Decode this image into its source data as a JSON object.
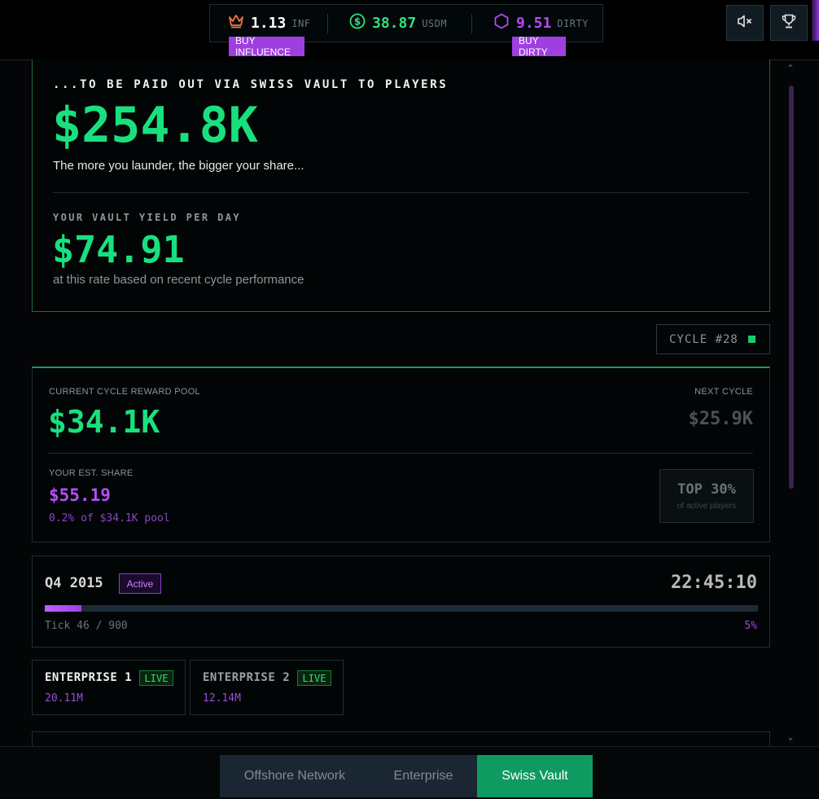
{
  "topbar": {
    "influence": {
      "value": "1.13",
      "unit": "INF",
      "buy_label": "BUY INFLUENCE",
      "color": "#f1743a"
    },
    "usdm": {
      "value": "38.87",
      "unit": "USDM",
      "color": "#2fe07c"
    },
    "dirty": {
      "value": "9.51",
      "unit": "DIRTY",
      "buy_label": "BUY DIRTY",
      "color": "#b24bf0"
    },
    "buttons": [
      "mute-icon",
      "trophy-icon"
    ]
  },
  "vault": {
    "eyebrow": "...TO BE PAID OUT VIA SWISS VAULT TO PLAYERS",
    "amount": "$254.8K",
    "tagline": "The more you launder, the bigger your share...",
    "yield_label": "YOUR VAULT YIELD PER DAY",
    "yield_amount": "$74.91",
    "yield_note": "at this rate based on recent cycle performance"
  },
  "cycle": {
    "label": "CYCLE #28"
  },
  "pool": {
    "current_label": "CURRENT CYCLE REWARD POOL",
    "current_amount": "$34.1K",
    "next_label": "NEXT CYCLE",
    "next_amount": "$25.9K",
    "share_label": "YOUR EST. SHARE",
    "share_amount": "$55.19",
    "share_note": "0.2% of $34.1K pool",
    "rank_title": "TOP 30%",
    "rank_sub": "of active players"
  },
  "quarter": {
    "title": "Q4 2015",
    "badge": "Active",
    "timer": "22:45:10",
    "tick": "Tick 46 / 900",
    "percent_label": "5%",
    "progress": 0.051
  },
  "enterprises": [
    {
      "name": "ENTERPRISE 1",
      "status": "LIVE",
      "value": "20.11M"
    },
    {
      "name": "ENTERPRISE 2",
      "status": "LIVE",
      "value": "12.14M"
    }
  ],
  "nav": {
    "tabs": [
      "Offshore Network",
      "Enterprise",
      "Swiss Vault"
    ],
    "active": "Swiss Vault"
  },
  "colors": {
    "green": "#19e07e",
    "purple": "#a03fe0",
    "accent_nav": "#0f9a62"
  }
}
